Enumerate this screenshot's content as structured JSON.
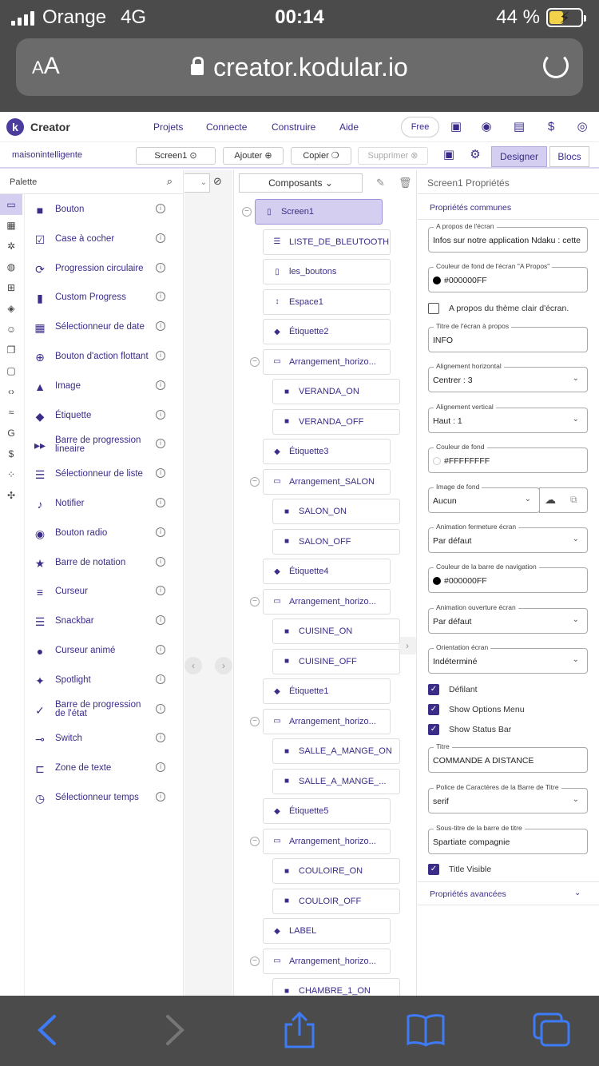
{
  "status": {
    "carrier": "Orange",
    "network": "4G",
    "time": "00:14",
    "battery": "44 %"
  },
  "safari": {
    "text_size": "AA",
    "url": "creator.kodular.io"
  },
  "header": {
    "brand": "Creator",
    "nav": [
      "Projets",
      "Connecte",
      "Construire",
      "Aide"
    ],
    "free": "Free"
  },
  "toolbar": {
    "project": "maisonintelligente",
    "screen": "Screen1",
    "add": "Ajouter",
    "copy": "Copier",
    "delete": "Supprimer",
    "designer": "Designer",
    "blocks": "Blocs"
  },
  "palette": {
    "title": "Palette",
    "items": [
      {
        "label": "Bouton",
        "icon": "button-icon"
      },
      {
        "label": "Case à cocher",
        "icon": "checkbox-icon"
      },
      {
        "label": "Progression circulaire",
        "icon": "circular-progress-icon"
      },
      {
        "label": "Custom Progress",
        "icon": "custom-progress-icon"
      },
      {
        "label": "Sélectionneur de date",
        "icon": "date-picker-icon"
      },
      {
        "label": "Bouton d'action flottant",
        "icon": "fab-icon"
      },
      {
        "label": "Image",
        "icon": "image-icon"
      },
      {
        "label": "Étiquette",
        "icon": "label-icon"
      },
      {
        "label": "Barre de progression lineaire",
        "icon": "linear-progress-icon"
      },
      {
        "label": "Sélectionneur de liste",
        "icon": "list-picker-icon"
      },
      {
        "label": "Notifier",
        "icon": "bell-icon"
      },
      {
        "label": "Bouton radio",
        "icon": "radio-icon"
      },
      {
        "label": "Barre de notation",
        "icon": "star-icon"
      },
      {
        "label": "Curseur",
        "icon": "slider-icon"
      },
      {
        "label": "Snackbar",
        "icon": "snackbar-icon"
      },
      {
        "label": "Curseur animé",
        "icon": "animated-slider-icon"
      },
      {
        "label": "Spotlight",
        "icon": "spotlight-icon"
      },
      {
        "label": "Barre de progression de l'état",
        "icon": "state-progress-icon"
      },
      {
        "label": "Switch",
        "icon": "switch-icon"
      },
      {
        "label": "Zone de texte",
        "icon": "textbox-icon"
      },
      {
        "label": "Sélectionneur temps",
        "icon": "time-picker-icon"
      }
    ]
  },
  "components": {
    "title": "Composants",
    "tree": [
      {
        "label": "Screen1",
        "type": "screen"
      },
      {
        "label": "LISTE_DE_BLEUTOOTH",
        "type": "list"
      },
      {
        "label": "les_boutons",
        "type": "phone"
      },
      {
        "label": "Espace1",
        "type": "space"
      },
      {
        "label": "Étiquette2",
        "type": "label"
      },
      {
        "label": "Arrangement_horizo...",
        "type": "arrangement"
      },
      {
        "label": "VERANDA_ON",
        "type": "button"
      },
      {
        "label": "VERANDA_OFF",
        "type": "button"
      },
      {
        "label": "Étiquette3",
        "type": "label"
      },
      {
        "label": "Arrangement_SALON",
        "type": "arrangement"
      },
      {
        "label": "SALON_ON",
        "type": "button"
      },
      {
        "label": "SALON_OFF",
        "type": "button"
      },
      {
        "label": "Étiquette4",
        "type": "label"
      },
      {
        "label": "Arrangement_horizo...",
        "type": "arrangement"
      },
      {
        "label": "CUISINE_ON",
        "type": "button"
      },
      {
        "label": "CUISINE_OFF",
        "type": "button"
      },
      {
        "label": "Étiquette1",
        "type": "label"
      },
      {
        "label": "Arrangement_horizo...",
        "type": "arrangement"
      },
      {
        "label": "SALLE_A_MANGE_ON",
        "type": "button"
      },
      {
        "label": "SALLE_A_MANGE_...",
        "type": "button"
      },
      {
        "label": "Étiquette5",
        "type": "label"
      },
      {
        "label": "Arrangement_horizo...",
        "type": "arrangement"
      },
      {
        "label": "COULOIRE_ON",
        "type": "button"
      },
      {
        "label": "COULOIR_OFF",
        "type": "button"
      },
      {
        "label": "LABEL",
        "type": "label"
      },
      {
        "label": "Arrangement_horizo...",
        "type": "arrangement"
      },
      {
        "label": "CHAMBRE_1_ON",
        "type": "button"
      }
    ]
  },
  "properties": {
    "title": "Screen1 Propriétés",
    "common": "Propriétés communes",
    "advanced": "Propriétés avancées",
    "about_label": "A propos de l'écran",
    "about_value": "Infos sur notre application Ndaku  :  cette",
    "about_bg_label": "Couleur de fond de l'écran \"A Propos\"",
    "about_bg_value": "#000000FF",
    "about_light_theme": "A propos du thème clair d'écran.",
    "about_title_label": "Titre de l'écran à propos",
    "about_title_value": "INFO",
    "halign_label": "Alignement horizontal",
    "halign_value": "Centrer : 3",
    "valign_label": "Alignement vertical",
    "valign_value": "Haut : 1",
    "bg_label": "Couleur de fond",
    "bg_value": "#FFFFFFFF",
    "bgimg_label": "Image de fond",
    "bgimg_value": "Aucun",
    "close_anim_label": "Animation fermeture écran",
    "close_anim_value": "Par défaut",
    "navbar_label": "Couleur de la barre de navigation",
    "navbar_value": "#000000FF",
    "open_anim_label": "Animation ouverture écran",
    "open_anim_value": "Par défaut",
    "orient_label": "Orientation écran",
    "orient_value": "Indéterminé",
    "scrollable": "Défilant",
    "show_options": "Show Options Menu",
    "show_status": "Show Status Bar",
    "title_label": "Titre",
    "title_value": "COMMANDE A DISTANCE",
    "font_label": "Police de Caractères de la Barre de Titre",
    "font_value": "serif",
    "subtitle_label": "Sous-titre de la barre de titre",
    "subtitle_value": "Spartiate  compagnie",
    "title_visible": "Title Visible"
  },
  "colors": {
    "accent": "#3a2d8a",
    "selected": "#d4cff0",
    "chrome": "#4b4b4b",
    "safari_blue": "#3d7bf7"
  }
}
